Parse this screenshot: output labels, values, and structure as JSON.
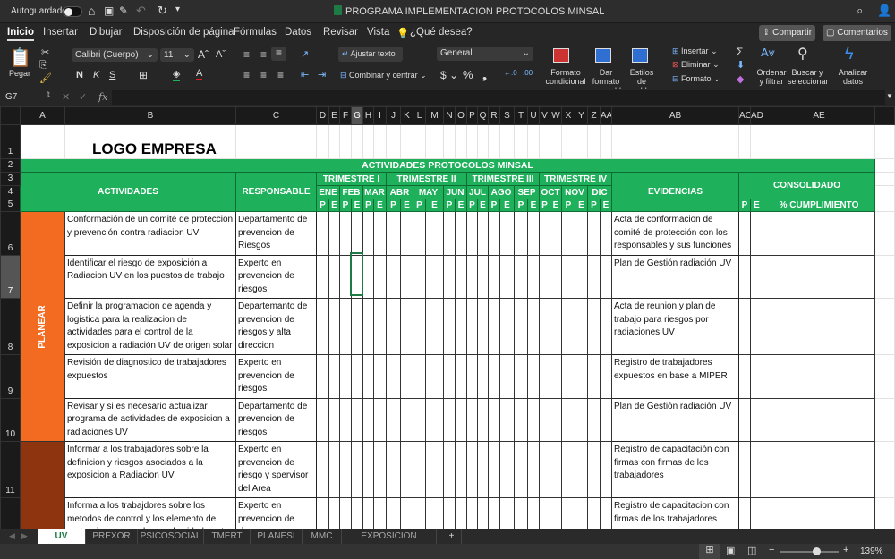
{
  "titlebar": {
    "autosave": "Autoguardado",
    "autosave_state": "off",
    "title": "PROGRAMA IMPLEMENTACION PROTOCOLOS MINSAL"
  },
  "menu": {
    "tabs": [
      "Inicio",
      "Insertar",
      "Dibujar",
      "Disposición de página",
      "Fórmulas",
      "Datos",
      "Revisar",
      "Vista"
    ],
    "tell_me": "¿Qué desea?",
    "share": "Compartir",
    "comments": "Comentarios"
  },
  "ribbon": {
    "paste": "Pegar",
    "font": "Calibri (Cuerpo)",
    "size": "11",
    "bold": "N",
    "italic": "K",
    "underline": "S",
    "wrap": "Ajustar texto",
    "merge": "Combinar y centrar",
    "number_format": "General",
    "cond_format": [
      "Formato",
      "condicional"
    ],
    "table_format": [
      "Dar formato",
      "como tabla"
    ],
    "cell_styles": [
      "Estilos",
      "de celda"
    ],
    "insert": "Insertar",
    "delete": "Eliminar",
    "format": "Formato",
    "sort": [
      "Ordenar",
      "y filtrar"
    ],
    "find": [
      "Buscar y",
      "seleccionar"
    ],
    "analyze": [
      "Analizar",
      "datos"
    ]
  },
  "formula_bar": {
    "name_box": "G7",
    "formula": ""
  },
  "columns": [
    "A",
    "B",
    "C",
    "D",
    "E",
    "F",
    "G",
    "H",
    "I",
    "J",
    "K",
    "L",
    "M",
    "N",
    "O",
    "P",
    "Q",
    "R",
    "S",
    "T",
    "U",
    "V",
    "W",
    "X",
    "Y",
    "Z",
    "AA",
    "AB",
    "AC",
    "AD",
    "AE",
    ""
  ],
  "selected_cell": "G7",
  "sheet": {
    "logo": "LOGO EMPRESA",
    "banner": "ACTIVIDADES PROTOCOLOS MINSAL",
    "h_activities": "ACTIVIDADES",
    "h_responsible": "RESPONSABLE",
    "h_evidence": "EVIDENCIAS",
    "h_consolidated": "CONSOLIDADO",
    "h_compliance": "% CUMPLIMIENTO",
    "p": "P",
    "e": "E",
    "quarters": [
      "TRIMESTRE I",
      "TRIMESTRE II",
      "TRIMESTRE III",
      "TRIMESTRE IV"
    ],
    "months": [
      "ENE",
      "FEB",
      "MAR",
      "ABR",
      "MAY",
      "JUN",
      "JUL",
      "AGO",
      "SEP",
      "OCT",
      "NOV",
      "DIC"
    ],
    "phases": [
      {
        "label": "PLANEAR",
        "color": "#f26b21"
      },
      {
        "label": "",
        "color": "#8e3510"
      }
    ],
    "rows": [
      {
        "n": "6",
        "activity": "Conformación de un comité de protección y prevención contra radiacion UV",
        "responsible": "Departamento de prevencion de Riesgos",
        "evidence": "Acta de conformacion de comité de protección con los responsables y sus funciones"
      },
      {
        "n": "7",
        "activity": "Identificar el riesgo de exposición a Radiacion UV en los puestos de trabajo",
        "responsible": "Experto en prevencion de riesgos",
        "evidence": "Plan de Gestión radiación UV"
      },
      {
        "n": "8",
        "activity": "Definir la programacion de agenda y logistica para la realizacion de actividades para el control de la exposicion a radiación UV de origen solar",
        "responsible": "Departemanto de prevencion de riesgos y alta direccion",
        "evidence": "Acta de reunion y plan de trabajo para riesgos por radiaciones UV"
      },
      {
        "n": "9",
        "activity": "Revisión de diagnostico de trabajadores expuestos",
        "responsible": "Experto en prevencion de riesgos",
        "evidence": "Registro de trabajadores expuestos en base a MIPER"
      },
      {
        "n": "10",
        "activity": "Revisar y si es necesario actualizar programa de actividades de exposicion a radiaciones UV",
        "responsible": "Departamento de prevencion de riesgos",
        "evidence": "Plan de Gestión radiación UV"
      },
      {
        "n": "11",
        "activity": "Informar a los trabajadores sobre la definicion y riesgos asociados a la exposicion a Radiacion UV",
        "responsible": "Experto en prevencion de riesgo y spervisor del Area",
        "evidence": "Registro de capacitación con firmas con firmas de los trabajadores"
      },
      {
        "n": "",
        "activity": "Informa a los trabajdores sobre los metodos de control y los elemento de proteccion personal para el cuidado ante la radiacion UV",
        "responsible": "Experto en prevencion de riesgos",
        "evidence": "Registro de capacitacion con firmas de los trabajadores"
      }
    ]
  },
  "sheet_tabs": [
    "UV",
    "PREXOR",
    "PSICOSOCIAL",
    "TMERT",
    "PLANESI",
    "MMC",
    "EXPOSICION ASBESTO"
  ],
  "active_sheet": "UV",
  "status": {
    "zoom": "139%",
    "zoom_level": 0.62,
    "view": "normal"
  },
  "colors": {
    "green": "#1eb05a",
    "orange": "#f26b21",
    "brown": "#8e3510",
    "selection": "#1e7b45"
  }
}
